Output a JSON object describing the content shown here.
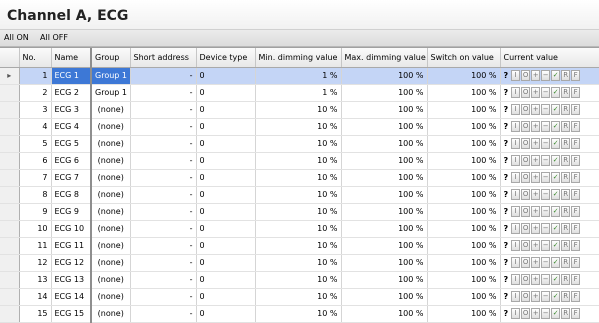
{
  "title": "Channel A, ECG",
  "toolbar": {
    "all_on": "All ON",
    "all_off": "All OFF"
  },
  "columns": {
    "no": "No.",
    "name": "Name",
    "group": "Group",
    "short_address": "Short address",
    "device_type": "Device type",
    "min_dimming": "Min. dimming value",
    "max_dimming": "Max. dimming value",
    "switch_on": "Switch on value",
    "current": "Current value"
  },
  "current_value_buttons": [
    "I",
    "O",
    "+",
    "−",
    "✓",
    "R",
    "F"
  ],
  "current_value_unknown": "?",
  "selected_marker": "▸",
  "rows": [
    {
      "no": "1",
      "name": "ECG 1",
      "group": "Group 1",
      "short": "-",
      "type": "0",
      "min": "1 %",
      "max": "100 %",
      "on": "100 %"
    },
    {
      "no": "2",
      "name": "ECG 2",
      "group": "Group 1",
      "short": "-",
      "type": "0",
      "min": "1 %",
      "max": "100 %",
      "on": "100 %"
    },
    {
      "no": "3",
      "name": "ECG 3",
      "group": "(none)",
      "short": "-",
      "type": "0",
      "min": "10 %",
      "max": "100 %",
      "on": "100 %"
    },
    {
      "no": "4",
      "name": "ECG 4",
      "group": "(none)",
      "short": "-",
      "type": "0",
      "min": "10 %",
      "max": "100 %",
      "on": "100 %"
    },
    {
      "no": "5",
      "name": "ECG 5",
      "group": "(none)",
      "short": "-",
      "type": "0",
      "min": "10 %",
      "max": "100 %",
      "on": "100 %"
    },
    {
      "no": "6",
      "name": "ECG 6",
      "group": "(none)",
      "short": "-",
      "type": "0",
      "min": "10 %",
      "max": "100 %",
      "on": "100 %"
    },
    {
      "no": "7",
      "name": "ECG 7",
      "group": "(none)",
      "short": "-",
      "type": "0",
      "min": "10 %",
      "max": "100 %",
      "on": "100 %"
    },
    {
      "no": "8",
      "name": "ECG 8",
      "group": "(none)",
      "short": "-",
      "type": "0",
      "min": "10 %",
      "max": "100 %",
      "on": "100 %"
    },
    {
      "no": "9",
      "name": "ECG 9",
      "group": "(none)",
      "short": "-",
      "type": "0",
      "min": "10 %",
      "max": "100 %",
      "on": "100 %"
    },
    {
      "no": "10",
      "name": "ECG 10",
      "group": "(none)",
      "short": "-",
      "type": "0",
      "min": "10 %",
      "max": "100 %",
      "on": "100 %"
    },
    {
      "no": "11",
      "name": "ECG 11",
      "group": "(none)",
      "short": "-",
      "type": "0",
      "min": "10 %",
      "max": "100 %",
      "on": "100 %"
    },
    {
      "no": "12",
      "name": "ECG 12",
      "group": "(none)",
      "short": "-",
      "type": "0",
      "min": "10 %",
      "max": "100 %",
      "on": "100 %"
    },
    {
      "no": "13",
      "name": "ECG 13",
      "group": "(none)",
      "short": "-",
      "type": "0",
      "min": "10 %",
      "max": "100 %",
      "on": "100 %"
    },
    {
      "no": "14",
      "name": "ECG 14",
      "group": "(none)",
      "short": "-",
      "type": "0",
      "min": "10 %",
      "max": "100 %",
      "on": "100 %"
    },
    {
      "no": "15",
      "name": "ECG 15",
      "group": "(none)",
      "short": "-",
      "type": "0",
      "min": "10 %",
      "max": "100 %",
      "on": "100 %"
    }
  ]
}
